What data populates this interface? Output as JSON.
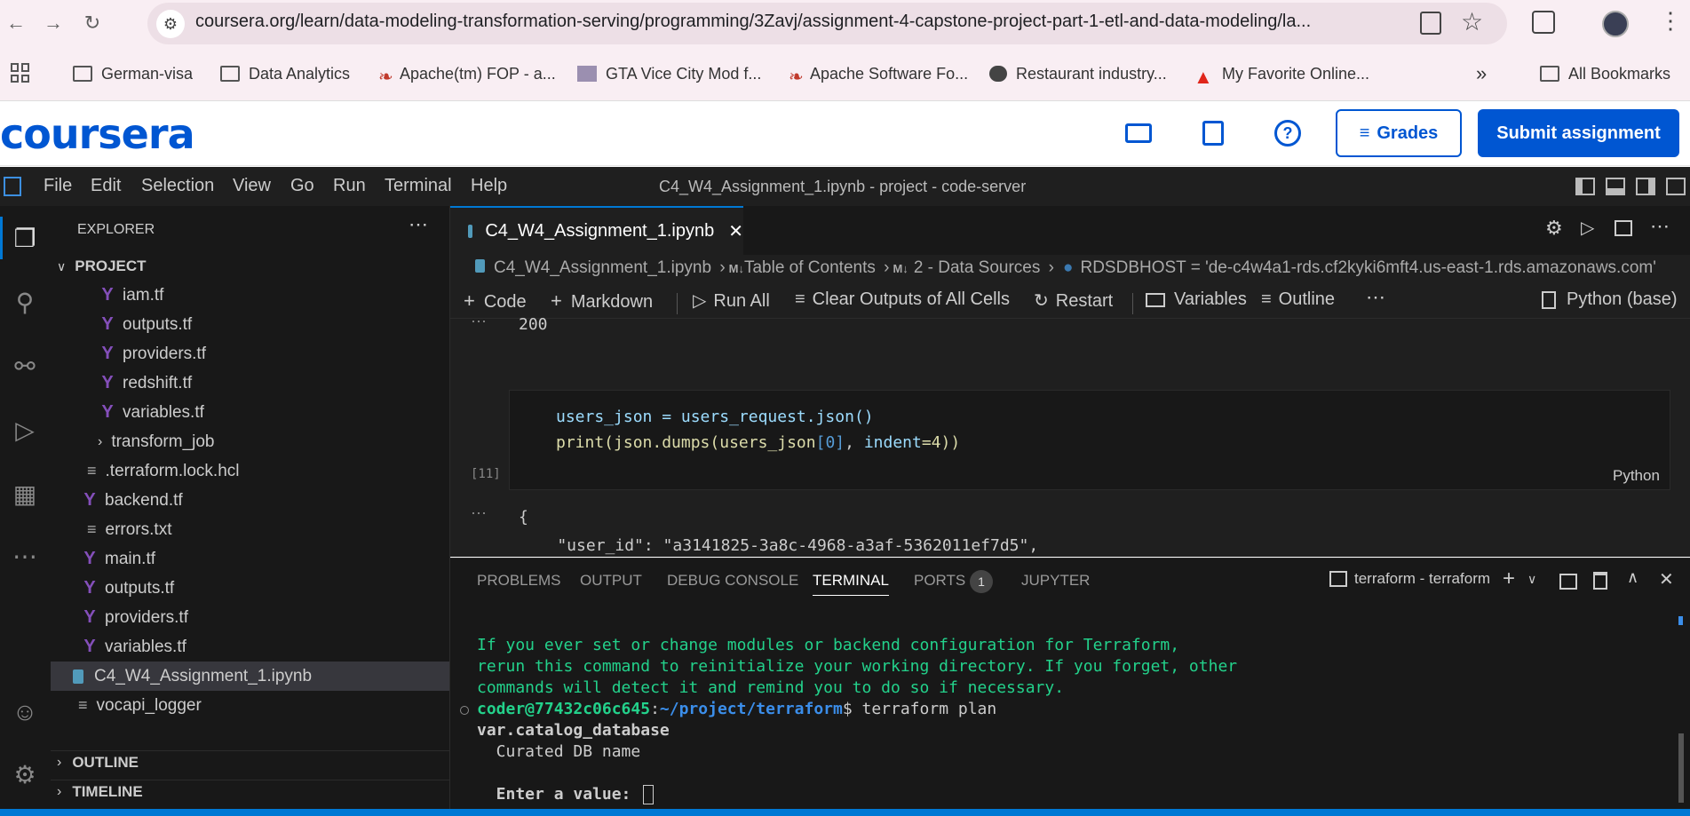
{
  "browser": {
    "url": "coursera.org/learn/data-modeling-transformation-serving/programming/3Zavj/assignment-4-capstone-project-part-1-etl-and-data-modeling/la...",
    "bookmarks": [
      "German-visa",
      "Data Analytics",
      "Apache(tm) FOP - a...",
      "GTA Vice City Mod f...",
      "Apache Software Fo...",
      "Restaurant industry...",
      "My Favorite Online..."
    ],
    "all_bookmarks": "All Bookmarks"
  },
  "coursera": {
    "logo": "coursera",
    "grades_label": "Grades",
    "submit_label": "Submit assignment",
    "brand_color": "#0056d2"
  },
  "vscode": {
    "menu": [
      "File",
      "Edit",
      "Selection",
      "View",
      "Go",
      "Run",
      "Terminal",
      "Help"
    ],
    "window_title": "C4_W4_Assignment_1.ipynb - project - code-server",
    "explorer_title": "EXPLORER",
    "project_label": "PROJECT",
    "tree": {
      "nested": [
        "iam.tf",
        "outputs.tf",
        "providers.tf",
        "redshift.tf",
        "variables.tf"
      ],
      "transform_job": "transform_job",
      "lock": ".terraform.lock.hcl",
      "backend": "backend.tf",
      "errors": "errors.txt",
      "main": "main.tf",
      "outputs": "outputs.tf",
      "providers": "providers.tf",
      "variables": "variables.tf",
      "notebook": "C4_W4_Assignment_1.ipynb",
      "logger": "vocapi_logger"
    },
    "outline": "OUTLINE",
    "timeline": "TIMELINE",
    "tab": "C4_W4_Assignment_1.ipynb",
    "breadcrumb": {
      "file": "C4_W4_Assignment_1.ipynb",
      "toc": "Table of Contents",
      "section": "2 - Data Sources",
      "var": "RDSDBHOST = 'de-c4w4a1-rds.cf2kyki6mft4.us-east-1.rds.amazonaws.com'"
    },
    "toolbar": {
      "code": "Code",
      "markdown": "Markdown",
      "run_all": "Run All",
      "clear": "Clear Outputs of All Cells",
      "restart": "Restart",
      "variables": "Variables",
      "outline": "Outline",
      "kernel": "Python (base)"
    },
    "cell": {
      "output_prev": "200",
      "line1": "users_json = users_request.json()",
      "line2_a": "print(json.dumps(users_json",
      "line2_b": "[0]",
      "line2_c": ", ",
      "line2_d": "indent",
      "line2_e": "=4))",
      "exec_count": "[11]",
      "lang": "Python",
      "out_brace": "{",
      "out_line": "    \"user_id\": \"a3141825-3a8c-4968-a3af-5362011ef7d5\","
    },
    "panel_tabs": [
      "PROBLEMS",
      "OUTPUT",
      "DEBUG CONSOLE",
      "TERMINAL",
      "PORTS",
      "JUPYTER"
    ],
    "ports_count": "1",
    "terminal_name": "terraform - terraform",
    "terminal": {
      "g1": "If you ever set or change modules or backend configuration for Terraform,",
      "g2": "rerun this command to reinitialize your working directory. If you forget, other",
      "g3": "commands will detect it and remind you to do so if necessary.",
      "prompt_user": "coder@77432c06c645",
      "prompt_colon": ":",
      "prompt_path": "~/project/terraform",
      "prompt_cmd": "$ terraform plan",
      "l1": "var.catalog_database",
      "l2": "  Curated DB name",
      "l3": "  Enter a value: "
    }
  }
}
